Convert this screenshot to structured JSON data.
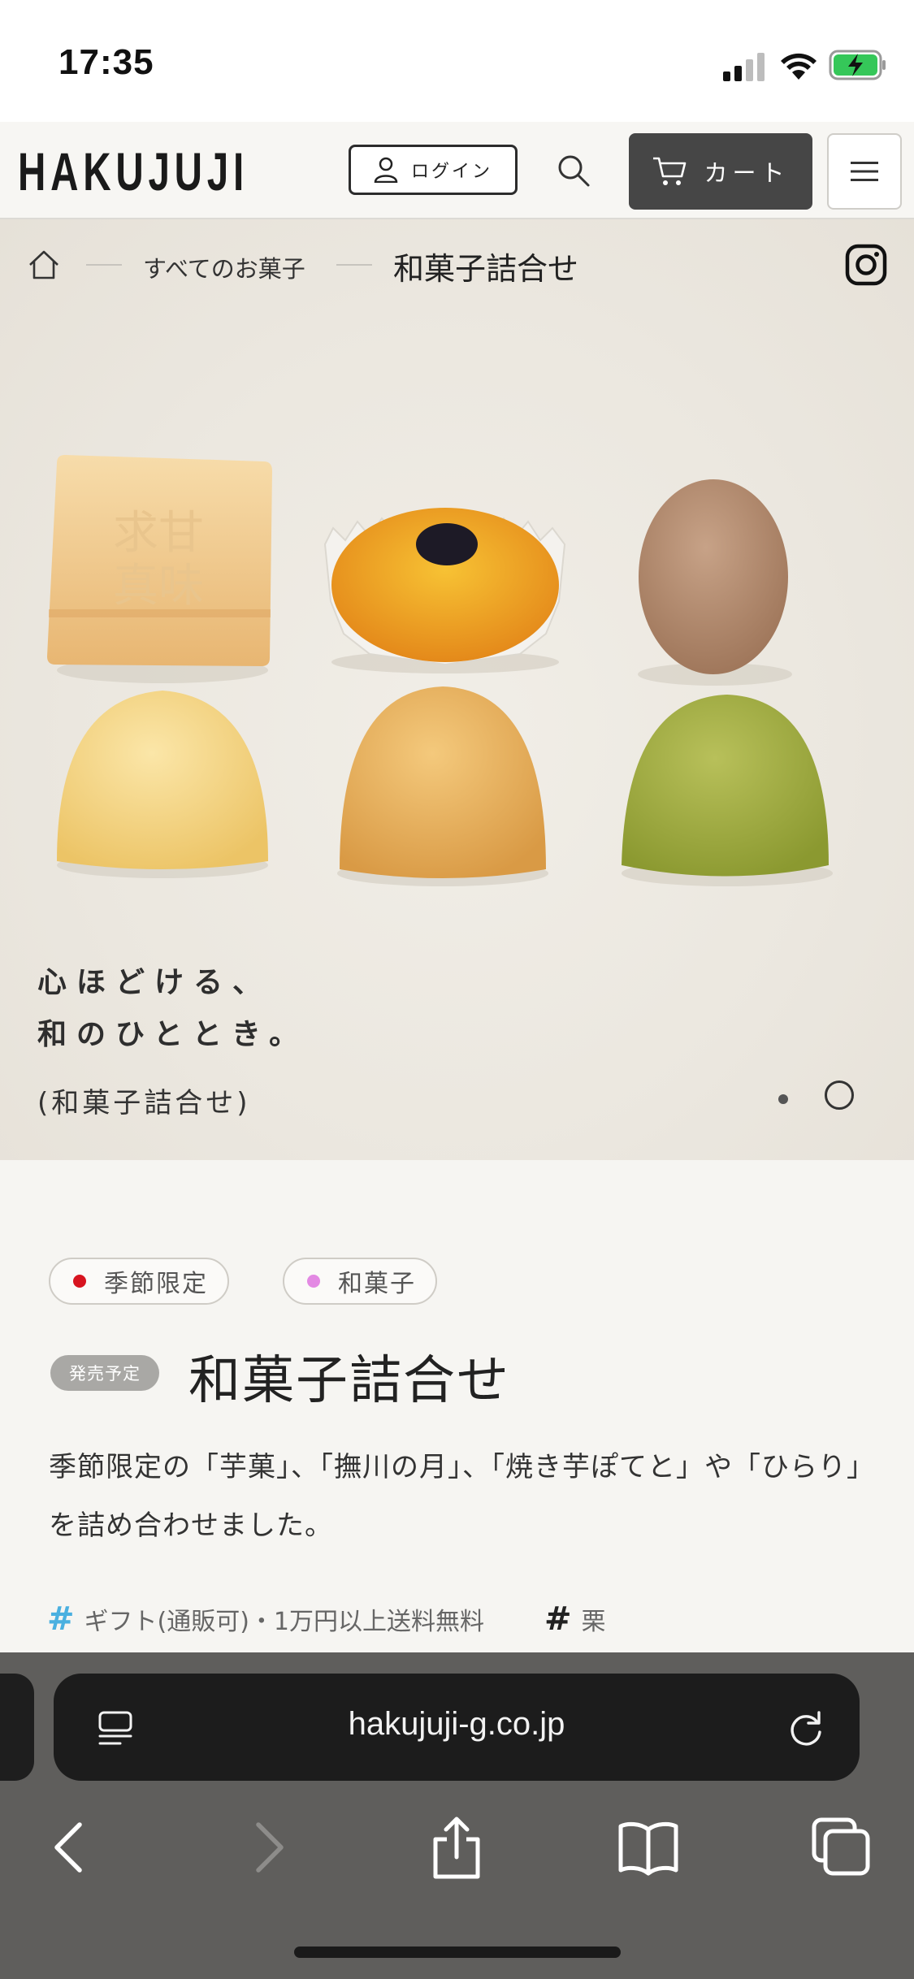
{
  "status": {
    "time": "17:35"
  },
  "header": {
    "logo": "HAKUJUJI",
    "login_label": "ログイン",
    "cart_label": "カート"
  },
  "breadcrumb": {
    "all": "すべてのお菓子",
    "current": "和菓子詰合せ"
  },
  "hero": {
    "copy_line1": "心ほどける、",
    "copy_line2": "和のひととき。",
    "sub": "(和菓子詰合せ)",
    "slides": 2,
    "active_slide": 2
  },
  "product": {
    "tags": [
      {
        "label": "季節限定",
        "color": "#d7141f"
      },
      {
        "label": "和菓子",
        "color": "#e389e3"
      }
    ],
    "badge": "発売予定",
    "title": "和菓子詰合せ",
    "description": "季節限定の「芋菓」、「撫川の月」、「焼き芋ぽてと」や「ひらり」を詰め合わせました。",
    "hashtags": [
      "ギフト(通販可)・1万円以上送料無料",
      "栗"
    ]
  },
  "browser": {
    "url": "hakujuji-g.co.jp"
  },
  "colors": {
    "cart_bg": "#464646",
    "hash_blue": "#4ab0e0",
    "battery_green": "#35c759"
  }
}
